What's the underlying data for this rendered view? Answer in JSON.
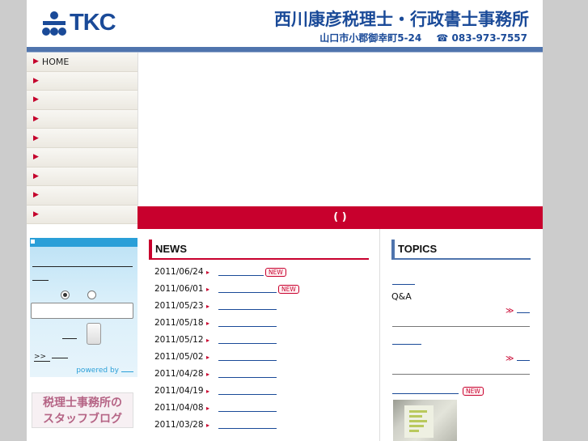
{
  "header": {
    "logo_text": "TKC",
    "office_name": "西川康彦税理士・行政書士事務所",
    "address": "山口市小郡御幸町5-24",
    "phone": "☎ 083-973-7557"
  },
  "sidenav": {
    "items": [
      {
        "label": "HOME"
      },
      {
        "label": ""
      },
      {
        "label": ""
      },
      {
        "label": ""
      },
      {
        "label": ""
      },
      {
        "label": ""
      },
      {
        "label": ""
      },
      {
        "label": ""
      },
      {
        "label": ""
      }
    ]
  },
  "banner": {
    "text": "( )"
  },
  "widget": {
    "more_label": ">>",
    "powered_label": "powered by"
  },
  "blog_banner": {
    "line1": "税理士事務所の",
    "line2": "スタッフブログ"
  },
  "news": {
    "title": "NEWS",
    "items": [
      {
        "date": "2011/06/24",
        "is_new": true
      },
      {
        "date": "2011/06/01",
        "is_new": true
      },
      {
        "date": "2011/05/23",
        "is_new": false
      },
      {
        "date": "2011/05/18",
        "is_new": false
      },
      {
        "date": "2011/05/12",
        "is_new": false
      },
      {
        "date": "2011/05/02",
        "is_new": false
      },
      {
        "date": "2011/04/28",
        "is_new": false
      },
      {
        "date": "2011/04/19",
        "is_new": false
      },
      {
        "date": "2011/04/08",
        "is_new": false
      },
      {
        "date": "2011/03/28",
        "is_new": false
      }
    ],
    "new_badge": "NEW",
    "arrow": "▸"
  },
  "topics": {
    "title": "TOPICS",
    "qa_label": "Q&A",
    "more_label": "≫",
    "new_badge": "NEW"
  },
  "colors": {
    "brand_blue": "#1a4a98",
    "accent_red": "#c8002d",
    "widget_blue": "#2a9fd8"
  }
}
